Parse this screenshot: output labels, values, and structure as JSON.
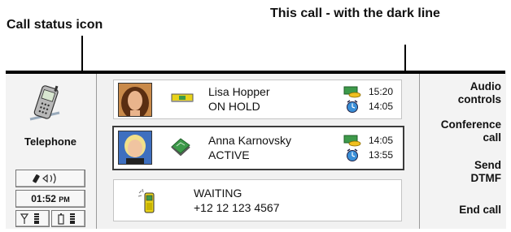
{
  "callouts": {
    "left": "Call status icon",
    "right": "This call - with the dark line"
  },
  "app": {
    "label": "Telephone",
    "clock": "01:52",
    "clock_ampm": "PM"
  },
  "calls": [
    {
      "name": "Lisa Hopper",
      "status": "ON HOLD",
      "time_call": "15:20",
      "time_total": "14:05"
    },
    {
      "name": "Anna Karnovsky",
      "status": "ACTIVE",
      "time_call": "14:05",
      "time_total": "13:55"
    },
    {
      "status": "WAITING",
      "number": "+12 12 123 4567"
    }
  ],
  "softkeys": {
    "audio_line1": "Audio",
    "audio_line2": "controls",
    "conference_line1": "Conference",
    "conference_line2": "call",
    "dtmf_line1": "Send",
    "dtmf_line2": "DTMF",
    "end_call": "End call"
  },
  "colors": {
    "accent_green": "#3d9a4a",
    "battery_yellow": "#e8d21a",
    "dark_line": "#3c3c3c"
  }
}
